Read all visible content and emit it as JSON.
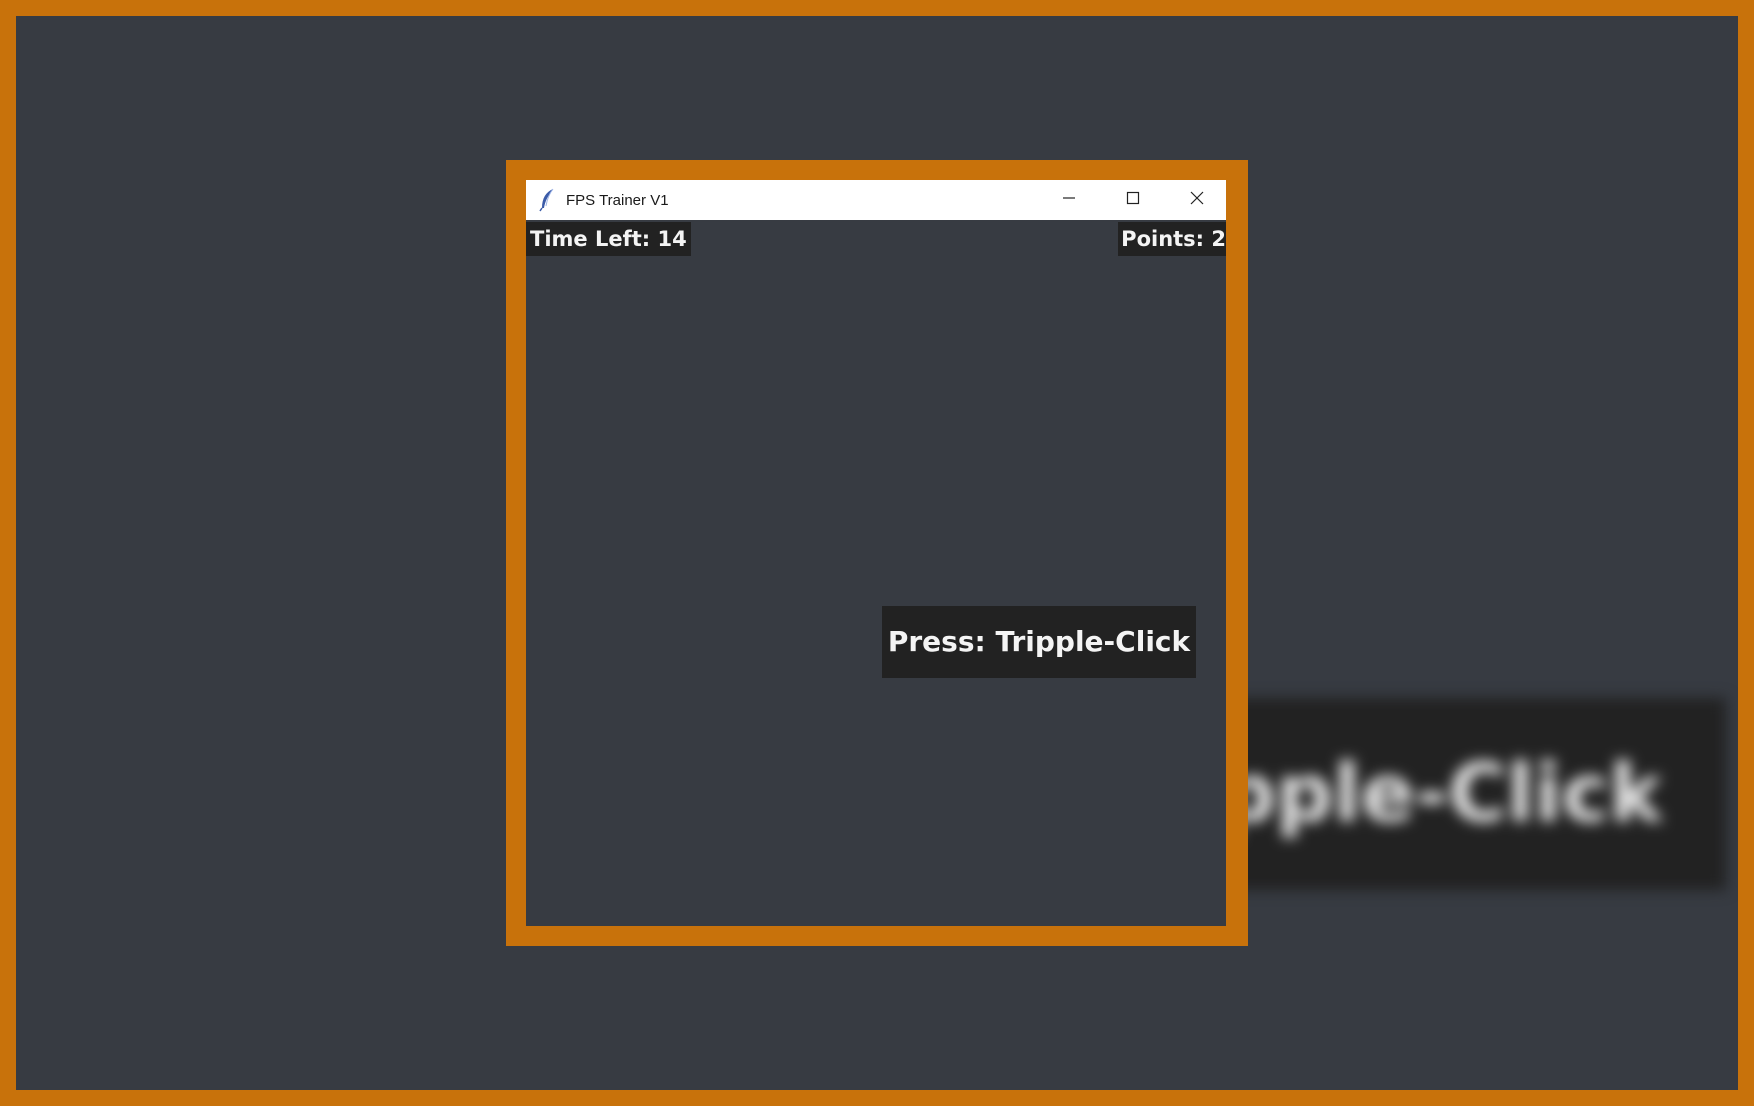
{
  "background": {
    "blurred_prompt_label": "Tripple-Click"
  },
  "window": {
    "title": "FPS Trainer V1",
    "icon": "feather-icon",
    "controls": {
      "minimize": "minimize-icon",
      "maximize": "maximize-icon",
      "close": "close-icon"
    }
  },
  "hud": {
    "time_left": "Time Left: 14",
    "points": "Points: 2"
  },
  "target": {
    "prompt": "Press: Tripple-Click"
  },
  "colors": {
    "accent_border": "#c8720b",
    "canvas": "#373b42",
    "label_bg": "#222222",
    "label_text": "#f4f4f4"
  }
}
